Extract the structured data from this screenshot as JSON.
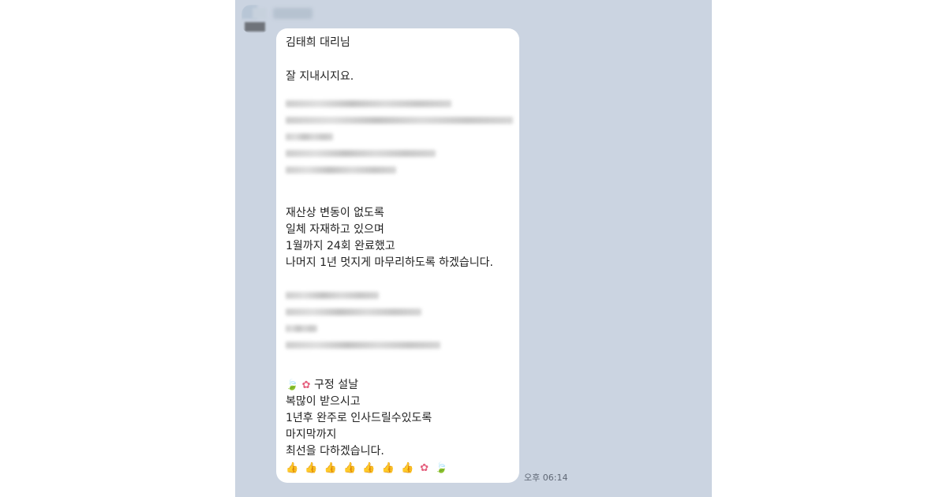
{
  "chat": {
    "message": {
      "greeting": "김태희 대리님",
      "intro": "잘 지내시지요.",
      "paragraph1": [
        "재산상 변동이 없도록",
        "일체 자재하고 있으며",
        "1월까지 24회 완료했고",
        "나머지 1년 멋지게 마무리하도록 하겠습니다."
      ],
      "paragraph2": {
        "line1_text": "구정 설날",
        "line1_icons": [
          "leaf-icon",
          "flower-icon"
        ],
        "lines": [
          "복많이 받으시고",
          "1년후 완주로 인사드릴수있도록",
          "마지막까지",
          "최선을 다하겠습니다."
        ]
      },
      "emoji_row": [
        "thumbs-up-icon",
        "thumbs-up-icon",
        "thumbs-up-icon",
        "thumbs-up-icon",
        "thumbs-up-icon",
        "thumbs-up-icon",
        "thumbs-up-icon",
        "flower-icon",
        "leaf-icon"
      ]
    },
    "timestamp": "오후 06:14",
    "colors": {
      "chat_background": "#cbd4e1",
      "bubble": "#ffffff",
      "text": "#222222"
    }
  }
}
